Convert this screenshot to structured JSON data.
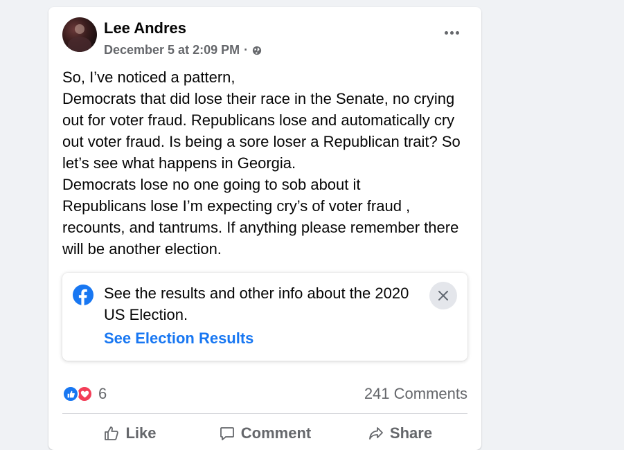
{
  "post": {
    "author": "Lee Andres",
    "timestamp": "December 5 at 2:09 PM",
    "separator": "·",
    "privacy_icon": "globe-icon",
    "more_icon": "more-options-icon",
    "text": "So, I’ve noticed a pattern,\nDemocrats that did lose their race in the Senate, no crying out for voter fraud. Republicans lose and automatically cry out voter fraud. Is being a sore loser a Republican trait? So let’s see what happens in Georgia.\nDemocrats lose no one going to sob about it\nRepublicans lose I’m expecting cry’s of voter fraud , recounts,  and tantrums. If anything please remember there will be another election."
  },
  "election_card": {
    "text": "See the results and other info about the 2020 US Election.",
    "link": "See Election Results",
    "icon": "facebook-logo-icon",
    "close_icon": "close-icon"
  },
  "stats": {
    "reaction_icons": [
      "like-reaction-icon",
      "love-reaction-icon"
    ],
    "reaction_count": "6",
    "comments": "241 Comments"
  },
  "actions": {
    "like": "Like",
    "comment": "Comment",
    "share": "Share"
  },
  "colors": {
    "accent": "#1877f2",
    "love": "#f33e58",
    "secondary_text": "#65676b",
    "background": "#f0f2f5"
  }
}
